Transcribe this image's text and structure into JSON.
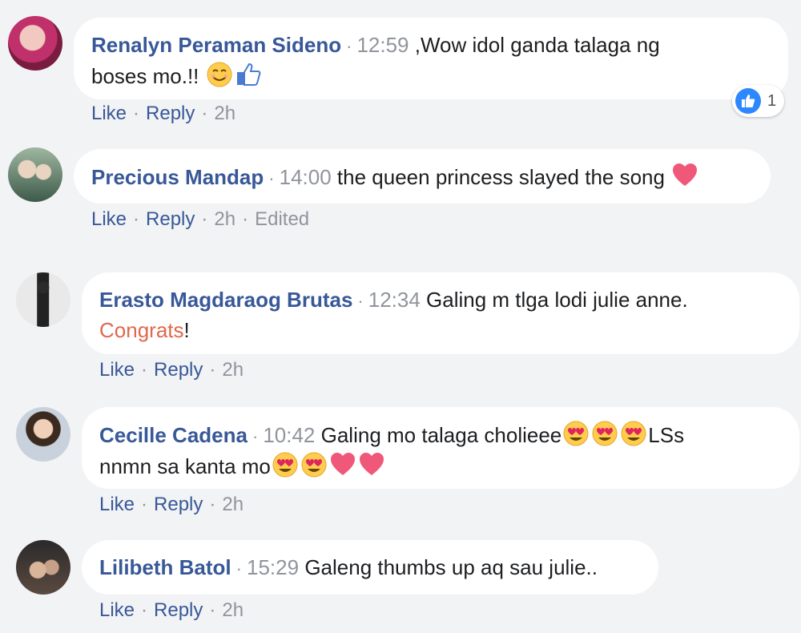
{
  "comments": [
    {
      "name": "Renalyn Peraman Sideno",
      "time": "12:59",
      "text": ",Wow idol ganda talaga ng",
      "text2": "boses mo.!!",
      "actions": {
        "like": "Like",
        "reply": "Reply",
        "age": "2h"
      },
      "reaction_count": "1"
    },
    {
      "name": "Precious Mandap",
      "time": "14:00",
      "text": "the queen princess slayed the song",
      "actions": {
        "like": "Like",
        "reply": "Reply",
        "age": "2h",
        "edited": "Edited"
      }
    },
    {
      "name": "Erasto Magdaraog Brutas",
      "time": "12:34",
      "text": "Galing m tlga lodi julie anne.",
      "highlight": "Congrats",
      "text_after": "!",
      "actions": {
        "like": "Like",
        "reply": "Reply",
        "age": "2h"
      }
    },
    {
      "name": "Cecille Cadena",
      "time": "10:42",
      "text": "Galing mo talaga cholieee",
      "text_mid": "LSs",
      "text2": "nnmn sa kanta mo",
      "actions": {
        "like": "Like",
        "reply": "Reply",
        "age": "2h"
      }
    },
    {
      "name": "Lilibeth Batol",
      "time": "15:29",
      "text": "Galeng thumbs up aq sau julie..",
      "actions": {
        "like": "Like",
        "reply": "Reply",
        "age": "2h"
      }
    }
  ],
  "separator": "·",
  "colors": {
    "background": "#f2f3f5",
    "name": "#385898",
    "meta": "#90949c",
    "highlight": "#e0684b",
    "like_blue": "#2d88ff"
  }
}
